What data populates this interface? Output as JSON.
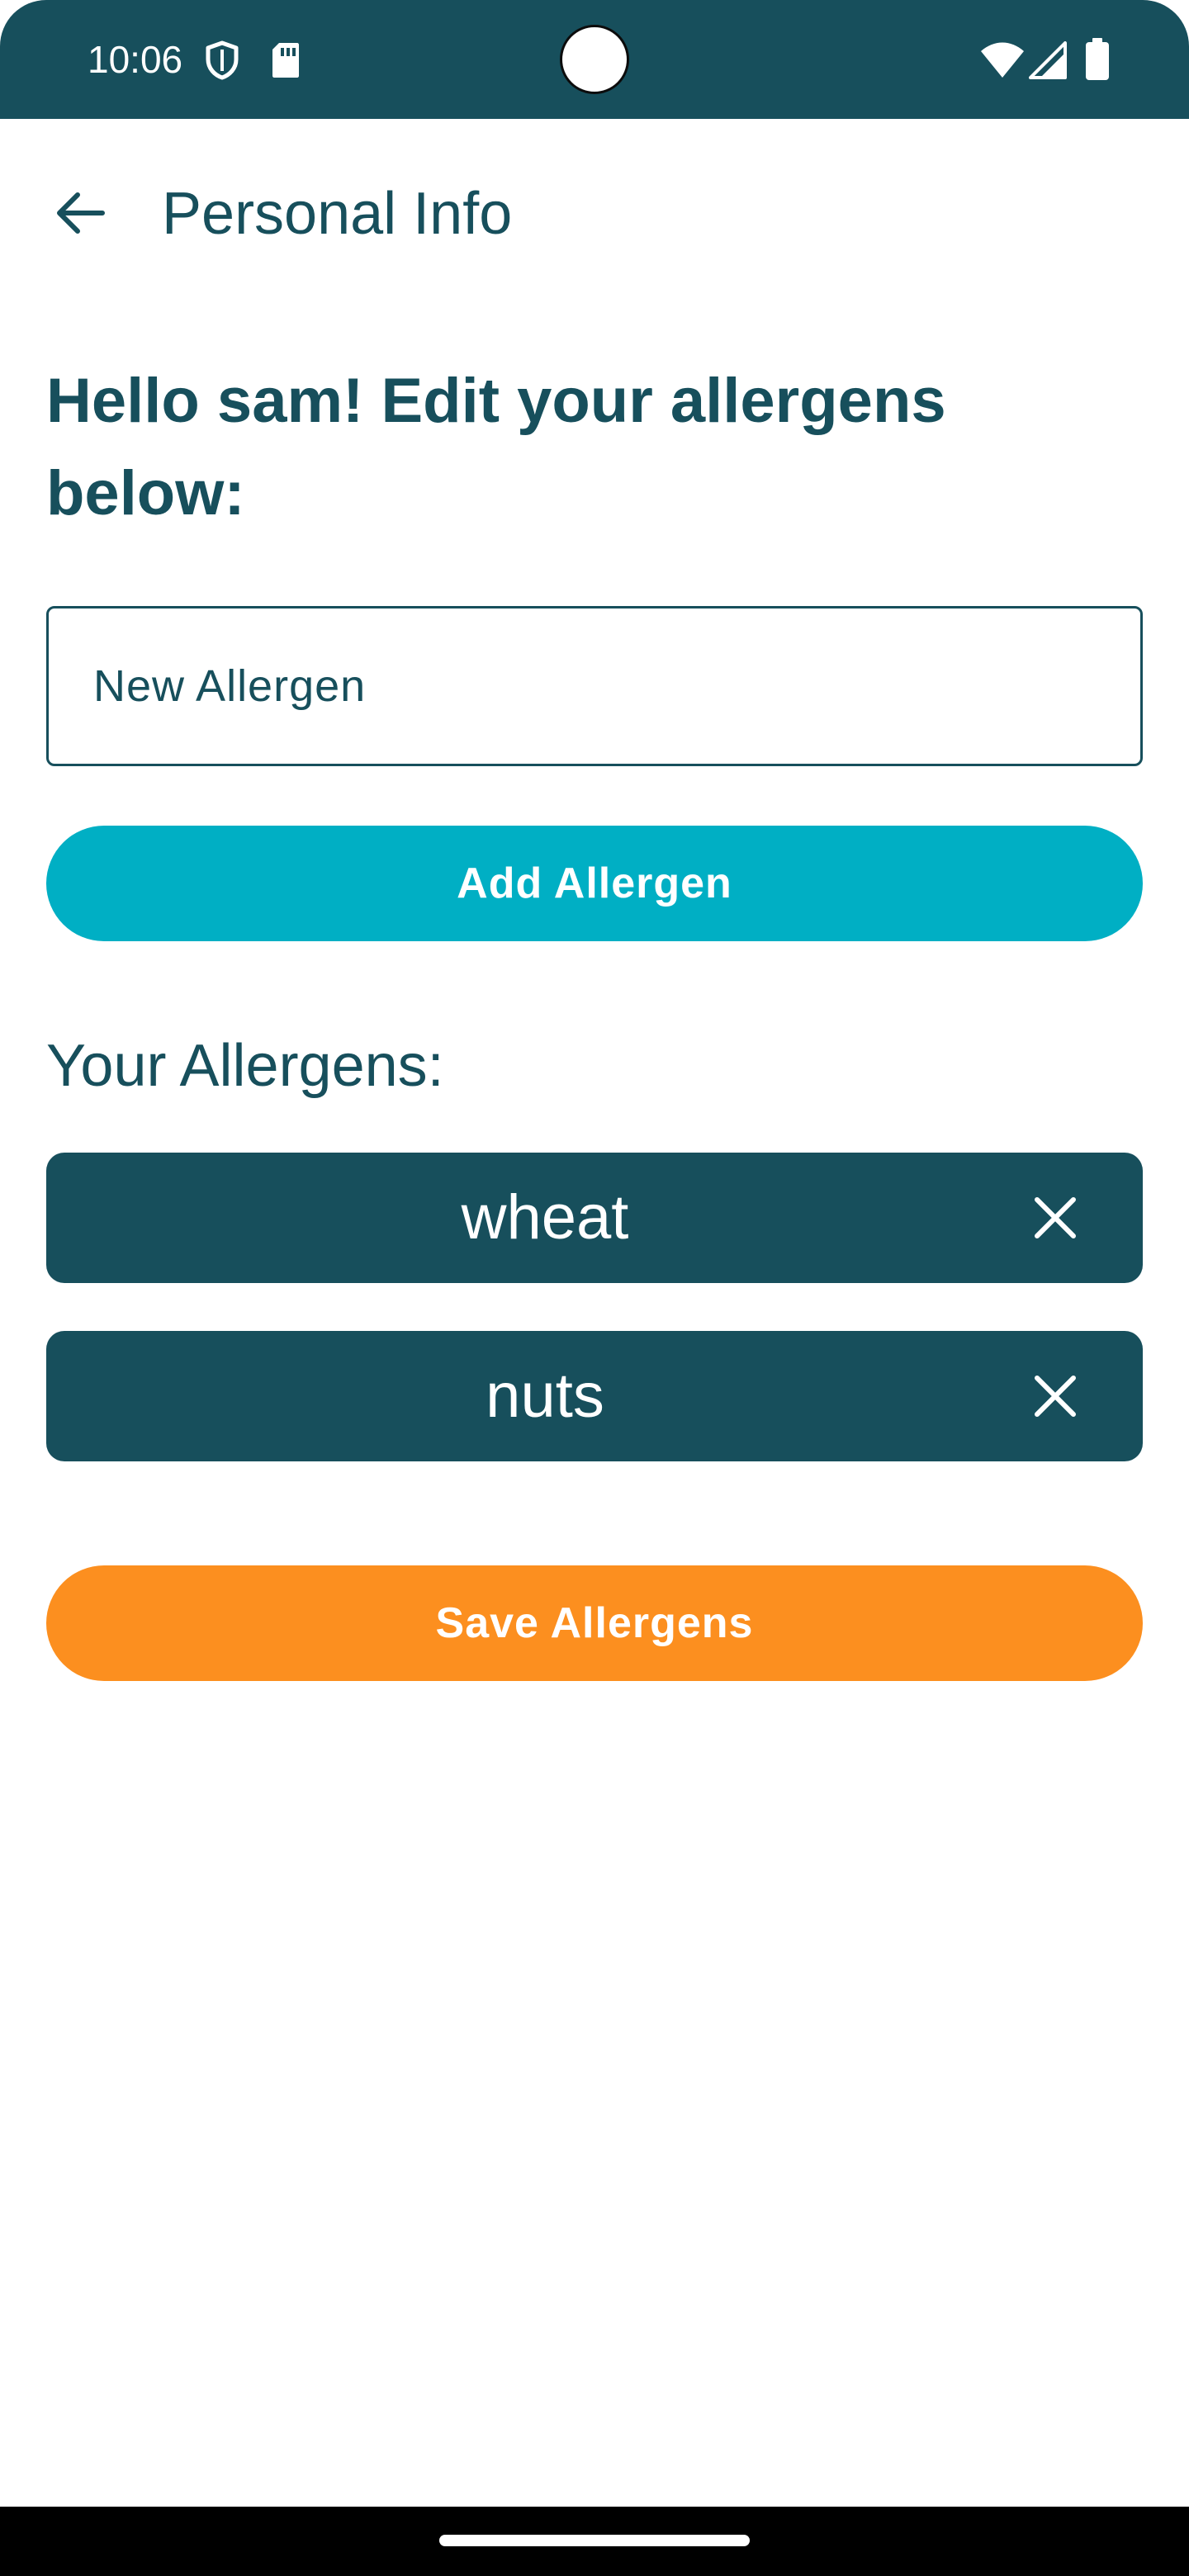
{
  "status_bar": {
    "time": "10:06",
    "left_icons": [
      "shield-icon",
      "sd-card-icon"
    ],
    "right_icons": [
      "wifi-icon",
      "cellular-signal-icon",
      "battery-icon"
    ],
    "background_color": "#174f5c"
  },
  "app_bar": {
    "back_icon": "arrow-left-icon",
    "title": "Personal Info"
  },
  "greeting": "Hello sam! Edit your allergens below:",
  "new_allergen_field": {
    "value": "",
    "placeholder": "New Allergen"
  },
  "add_button": {
    "label": "Add Allergen",
    "color": "#00afc4"
  },
  "allergens_section": {
    "heading": "Your Allergens:",
    "items": [
      {
        "label": "wheat",
        "remove_icon": "close-icon"
      },
      {
        "label": "nuts",
        "remove_icon": "close-icon"
      }
    ],
    "chip_color": "#174f5c"
  },
  "save_button": {
    "label": "Save Allergens",
    "color": "#fc8f1f"
  },
  "theme": {
    "primary_text": "#174f5c",
    "background": "#ffffff"
  }
}
